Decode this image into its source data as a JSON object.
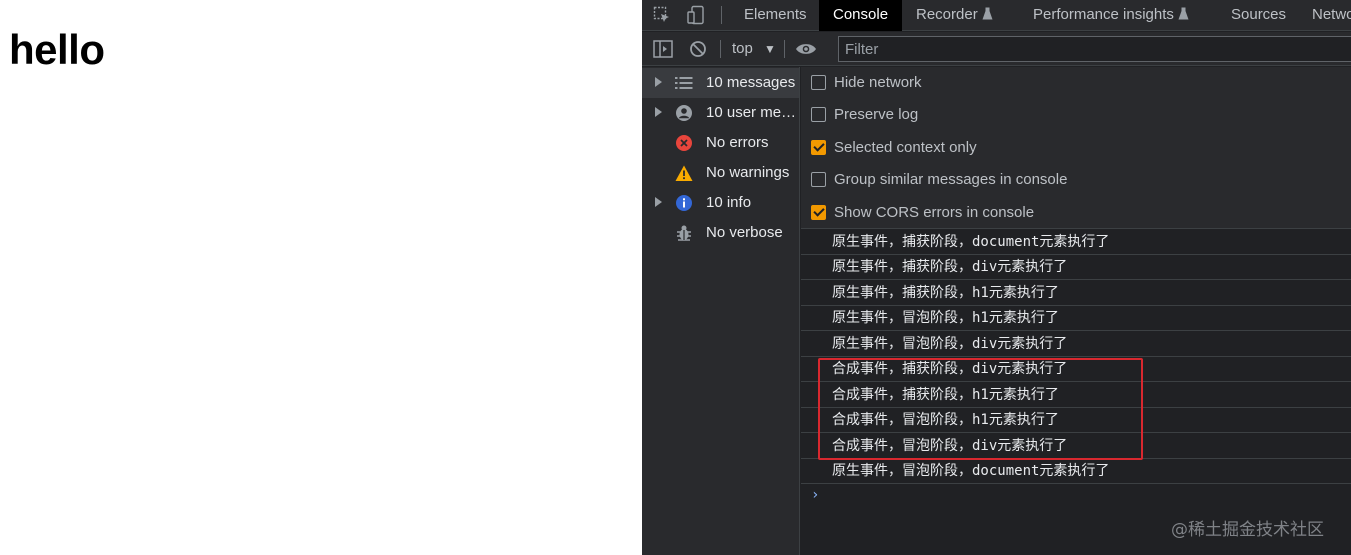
{
  "page": {
    "heading": "hello"
  },
  "devtools": {
    "tabs": [
      {
        "label": "Elements",
        "active": false
      },
      {
        "label": "Console",
        "active": true
      },
      {
        "label": "Recorder",
        "active": false,
        "icon": "flask-icon"
      },
      {
        "label": "Performance insights",
        "active": false,
        "icon": "flask-icon"
      },
      {
        "label": "Sources",
        "active": false
      },
      {
        "label": "Netwo",
        "active": false
      }
    ],
    "toolbar": {
      "context": "top",
      "filter_placeholder": "Filter"
    },
    "sidebar": [
      {
        "label": "10 messages",
        "icon": "list-icon",
        "expandable": true,
        "selected": true
      },
      {
        "label": "10 user mes...",
        "icon": "user-icon",
        "expandable": true,
        "selected": false
      },
      {
        "label": "No errors",
        "icon": "error-icon",
        "expandable": false,
        "selected": false
      },
      {
        "label": "No warnings",
        "icon": "warning-icon",
        "expandable": false,
        "selected": false
      },
      {
        "label": "10 info",
        "icon": "info-icon",
        "expandable": true,
        "selected": false
      },
      {
        "label": "No verbose",
        "icon": "bug-icon",
        "expandable": false,
        "selected": false
      }
    ],
    "settings": [
      {
        "label": "Hide network",
        "checked": false
      },
      {
        "label": "Preserve log",
        "checked": false
      },
      {
        "label": "Selected context only",
        "checked": true
      },
      {
        "label": "Group similar messages in console",
        "checked": false
      },
      {
        "label": "Show CORS errors in console",
        "checked": true
      }
    ],
    "messages": [
      "原生事件，捕获阶段，document元素执行了",
      "原生事件，捕获阶段，div元素执行了",
      "原生事件，捕获阶段，h1元素执行了",
      "原生事件，冒泡阶段，h1元素执行了",
      "原生事件，冒泡阶段，div元素执行了",
      "合成事件，捕获阶段，div元素执行了",
      "合成事件，捕获阶段，h1元素执行了",
      "合成事件，冒泡阶段，h1元素执行了",
      "合成事件，冒泡阶段，div元素执行了",
      "原生事件，冒泡阶段，document元素执行了"
    ],
    "prompt": "›",
    "colors": {
      "checkbox_checked": "#f29900",
      "highlight_border": "#d9282f",
      "error": "#e8453c",
      "warning": "#f9ab00",
      "info": "#3367d6"
    }
  },
  "watermark": "@稀土掘金技术社区"
}
